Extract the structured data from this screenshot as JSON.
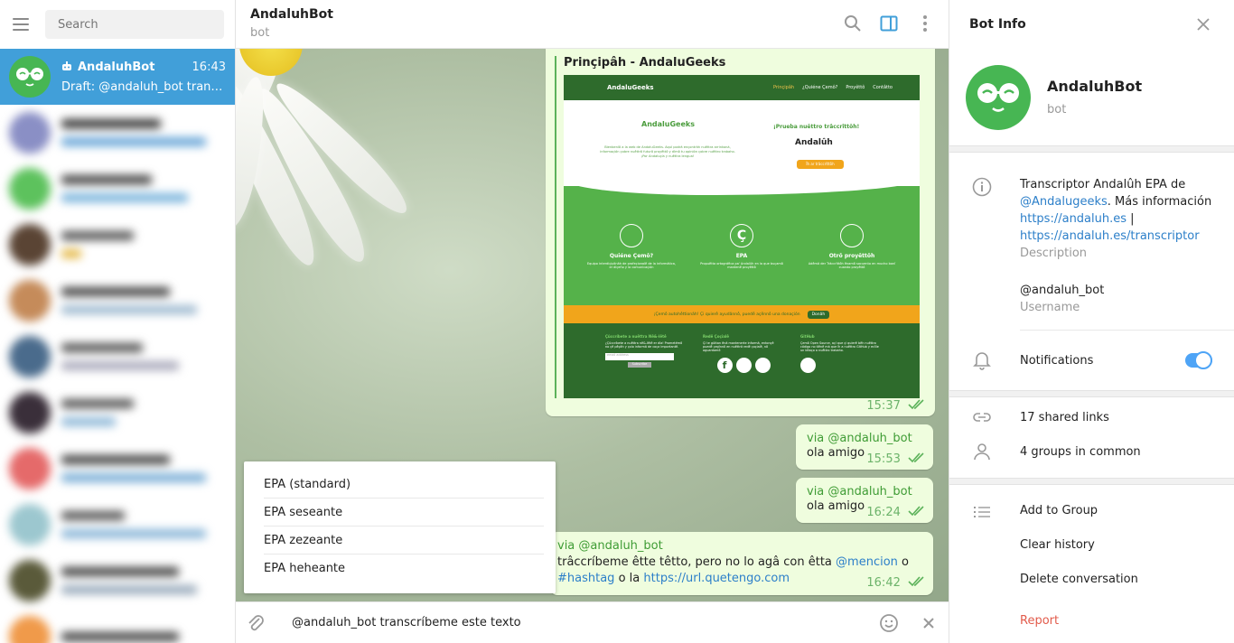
{
  "sidebar": {
    "search_placeholder": "Search",
    "active_chat": {
      "name": "AndaluhBot",
      "time": "16:43",
      "draft_prefix": "Draft:",
      "draft_text": "@andaluh_bot transcr..."
    }
  },
  "chat": {
    "title": "AndaluhBot",
    "status": "bot",
    "preview": {
      "site_title": "Prinçipâh - AndaluGeeks",
      "time": "15:37",
      "site": {
        "nav": [
          "Prinçipâh",
          "¿Quiéne Çemô?",
          "Proyêttô",
          "Contâtto"
        ],
        "logo": "AndaluGeeks",
        "cta_title": "¡Prueba nuêttro trâccrîttôh!",
        "cta_logo": "Andalûh",
        "cta_button": "Îh ar trâccrîttôh",
        "hero_text": "Bienbeníô a la web de AndaluGeeks. Aquí podrâ ençontrâh nuêttra arrinkoná, informaçión çobre nuêttrô futurô proyêttô y dîmô tu opinión çobre nuêttro trabaho. ¡Por Andaluçía y nuêttra lengua!",
        "features": [
          {
            "title": "Quiéne Çemô?",
            "text": "Equipo interdiçiplinâh de profeçionalê de la informática, er diçeño y la comunicaçión"
          },
          {
            "title": "EPA",
            "text": "Propuêtta ortográfica pa' Andalûh en la que buçamô mantenê proyêttô"
          },
          {
            "title": "Otrô proyêttôh",
            "text": "Adêmâ der Trâccrîttôh ênamô socuento en mucho bonî cuando proyêttô"
          }
        ],
        "donate_text": "¡Çemô autohêttionâh! Çi quierê ayudânnô, puedê açênnô una donaçión",
        "donate_button": "Donâh",
        "footer": [
          {
            "title": "Çûccríbete a nuêttra Nê&-lêtê",
            "text": "¿Çûccríbete a nuêttra nê&-lêtê er dîa! Prometémô no çê pêçâh y çolo informâ de coça importantê."
          },
          {
            "title": "Redê Çoçialê",
            "text": "Çi te gûttan ênâ mantenerte informâ, entonçê puedê çegînnô en nuêttrâ redê çoçialê, nô aguardamô"
          },
          {
            "title": "GitHub",
            "text": "Çemô Open Source, açí que çi quierê bêh nuêttro código no tiênê má que îh a nuêttro GitHub y ecîlle un bîtaço a nuêttro trabaho."
          }
        ],
        "email_placeholder": "email address",
        "subscribe": "Subscribe"
      }
    },
    "messages": [
      {
        "via": "via @andaluh_bot",
        "text": "ola amigo",
        "time": "15:53"
      },
      {
        "via": "via @andaluh_bot",
        "text": "ola amigo",
        "time": "16:24"
      },
      {
        "via": "via @andaluh_bot",
        "text_1": "trâccríbeme êtte têtto, pero no lo agâ con êtta",
        "mention": "@mencion",
        "text_2": "o",
        "hashtag": "#hashtag",
        "text_3": "o la",
        "url": "https://url.quetengo.com",
        "time": "16:42"
      }
    ],
    "inline_results": [
      "EPA (standard)",
      "EPA seseante",
      "EPA zezeante",
      "EPA heheante"
    ],
    "composer_value": "@andaluh_bot transcríbeme este texto"
  },
  "info": {
    "header": "Bot Info",
    "name": "AndaluhBot",
    "status": "bot",
    "description_1": "Transcriptor Andalûh EPA de",
    "description_link": "@Andalugeeks",
    "description_2": ". Más información",
    "description_url1": "https://andaluh.es",
    "description_sep": "|",
    "description_url2": "https://andaluh.es/transcriptor",
    "description_label": "Description",
    "username": "@andaluh_bot",
    "username_label": "Username",
    "notifications_label": "Notifications",
    "notifications_on": true,
    "shared_links": "17 shared links",
    "groups_common": "4 groups in common",
    "add_to_group": "Add to Group",
    "clear_history": "Clear history",
    "delete_conversation": "Delete conversation",
    "report": "Report"
  },
  "colors": {
    "accent": "#419fd9",
    "bot_green": "#47b653",
    "bubble": "#effdde",
    "link": "#2c7fc9",
    "danger": "#e25b4b",
    "toggle": "#4ea4f6"
  }
}
